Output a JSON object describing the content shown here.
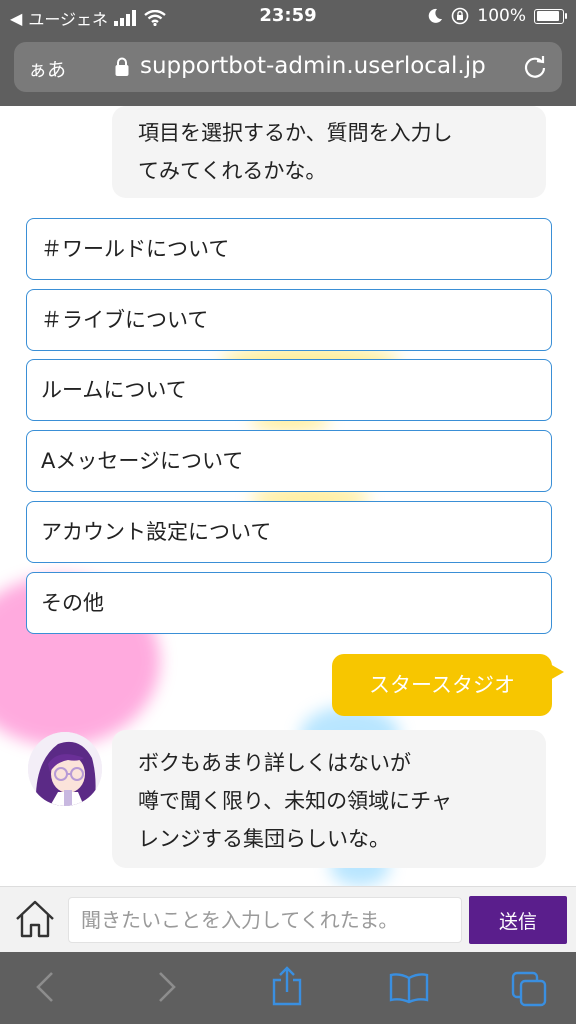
{
  "status": {
    "back_label": "◀",
    "carrier": "ユージェネ",
    "time": "23:59",
    "battery": "100%",
    "battery_level": 1.0
  },
  "browser": {
    "text_size": "ぁあ",
    "url": "supportbot-admin.userlocal.jp"
  },
  "chat": {
    "bot_message_1": {
      "line1": "項目を選択するか、質問を入力し",
      "line2": "てみてくれるかな。"
    },
    "options": [
      {
        "label": "＃ワールドについて"
      },
      {
        "label": "＃ライブについて"
      },
      {
        "label": "ルームについて"
      },
      {
        "label": "Aメッセージについて"
      },
      {
        "label": "アカウント設定について"
      },
      {
        "label": "その他"
      }
    ],
    "user_message": "スタースタジオ",
    "bot_message_2": {
      "line1": "ボクもあまり詳しくはないが",
      "line2": "噂で聞く限り、未知の領域にチャ",
      "line3": "レンジする集団らしいな。"
    }
  },
  "input": {
    "placeholder": "聞きたいことを入力してくれたま。",
    "send_label": "送信"
  },
  "colors": {
    "option_border": "#3a8fd6",
    "user_bubble": "#f7c600",
    "send_button": "#5a1e8c",
    "bot_bubble": "#f4f4f4"
  },
  "icons": {
    "toolbar": [
      "back-icon",
      "forward-icon",
      "share-icon",
      "bookmarks-icon",
      "tabs-icon"
    ]
  }
}
